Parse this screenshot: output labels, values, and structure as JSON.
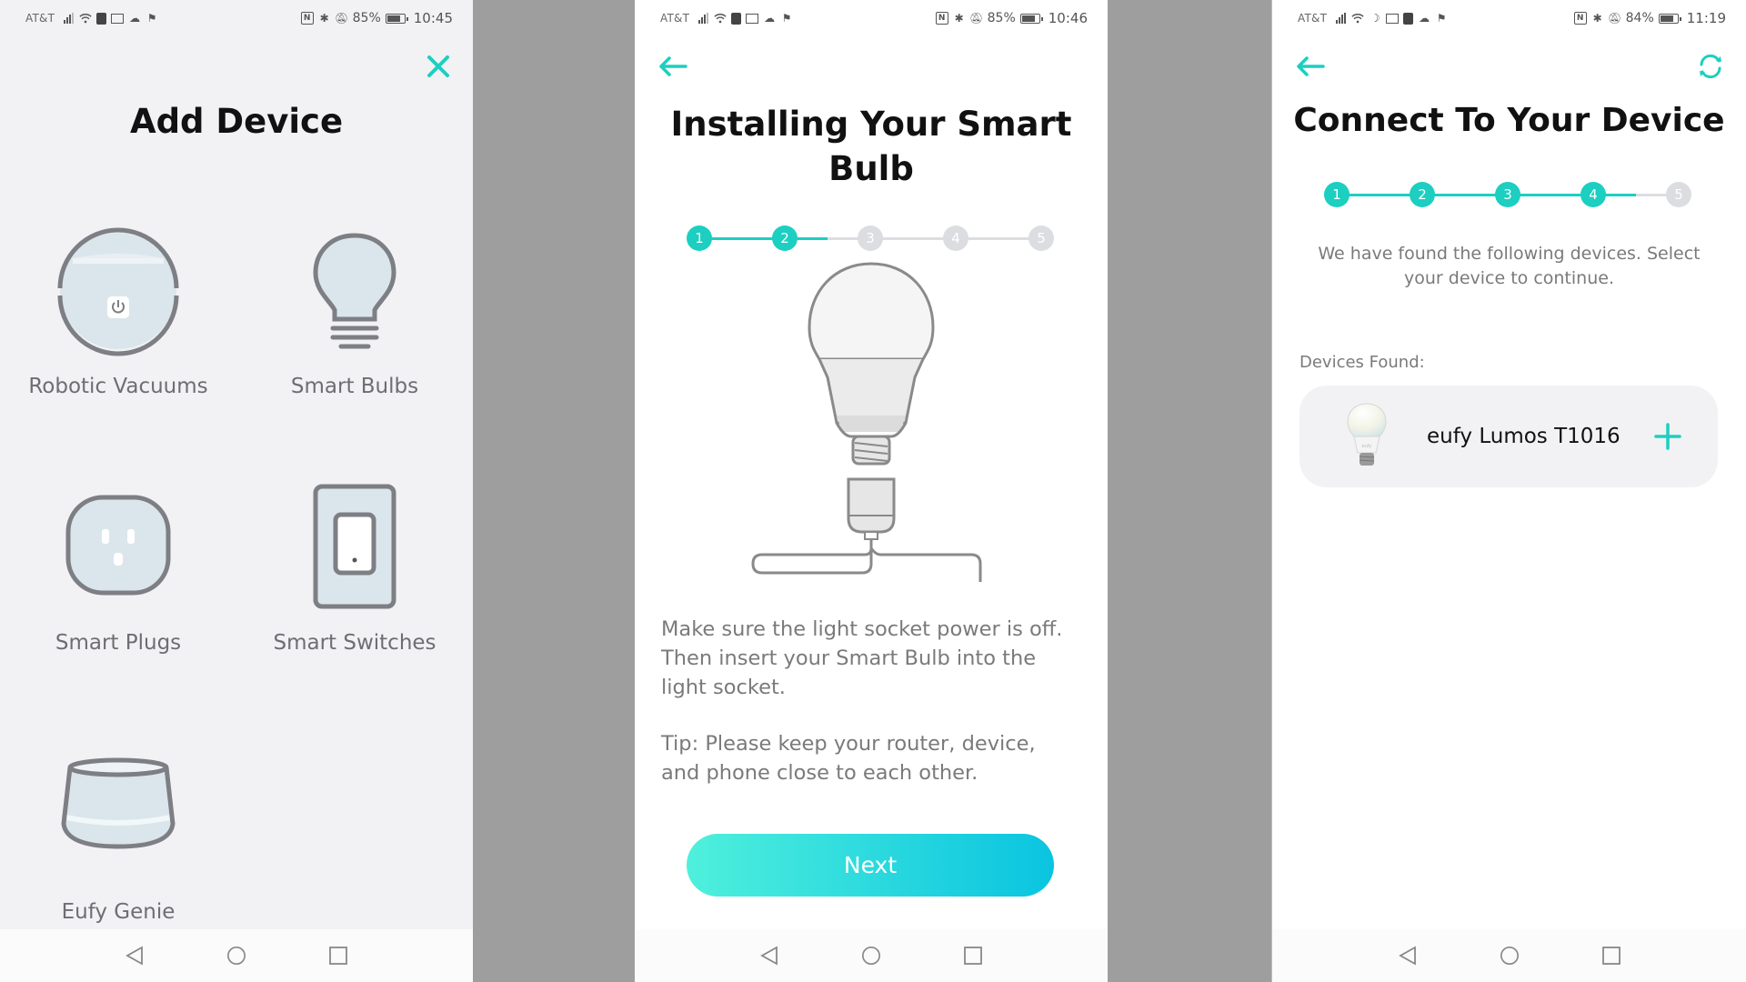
{
  "colors": {
    "accent": "#1ccfc0",
    "inactive_step": "#dcdde0",
    "text_gray": "#6d6e73",
    "gap_background": "#9e9e9e"
  },
  "screens": [
    {
      "status": {
        "carrier": "AT&T",
        "battery_pct": "85%",
        "battery_level": 0.85,
        "time": "10:45"
      },
      "close_icon": "close-icon",
      "title": "Add Device",
      "devices": [
        {
          "label": "Robotic Vacuums",
          "icon": "robot-vacuum-icon"
        },
        {
          "label": "Smart Bulbs",
          "icon": "light-bulb-icon"
        },
        {
          "label": "Smart Plugs",
          "icon": "smart-plug-icon"
        },
        {
          "label": "Smart Switches",
          "icon": "light-switch-icon"
        },
        {
          "label": "Eufy Genie",
          "icon": "smart-speaker-icon"
        }
      ]
    },
    {
      "status": {
        "carrier": "AT&T",
        "battery_pct": "85%",
        "battery_level": 0.85,
        "time": "10:46"
      },
      "back_icon": "back-arrow-icon",
      "title_line1": "Installing Your Smart",
      "title_line2": "Bulb",
      "steps": {
        "labels": [
          "1",
          "2",
          "3",
          "4",
          "5"
        ],
        "current": 2,
        "total": 5
      },
      "instruction_lines": [
        "Make sure the light socket power is off.",
        "Then insert your Smart Bulb into the",
        "light socket."
      ],
      "tip_lines": [
        "Tip: Please keep your router, device,",
        "and phone close to each other."
      ],
      "next_label": "Next"
    },
    {
      "status": {
        "carrier": "AT&T",
        "battery_pct": "84%",
        "battery_level": 0.84,
        "time": "11:19"
      },
      "back_icon": "back-arrow-icon",
      "refresh_icon": "refresh-icon",
      "title": "Connect To Your Device",
      "steps": {
        "labels": [
          "1",
          "2",
          "3",
          "4",
          "5"
        ],
        "current": 4,
        "total": 5
      },
      "description_lines": [
        "We have found the following devices. Select",
        "your device to continue."
      ],
      "devices_found_label": "Devices Found:",
      "found_devices": [
        {
          "name": "eufy Lumos T1016",
          "bulb_brand_text": "eufy"
        }
      ]
    }
  ],
  "navbar": {
    "back": "nav-back-icon",
    "home": "nav-home-icon",
    "recents": "nav-recents-icon"
  }
}
